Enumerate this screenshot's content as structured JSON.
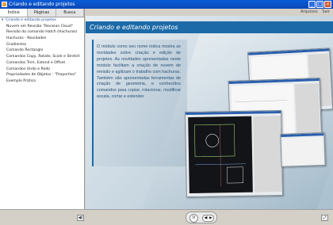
{
  "window": {
    "title": "Criando e editando projetos"
  },
  "top_links": {
    "files": "Arquivos",
    "exit": "Sair"
  },
  "tabs": [
    {
      "label": "Índice",
      "active": true
    },
    {
      "label": "Páginas",
      "active": false
    },
    {
      "label": "Busca",
      "active": false
    }
  ],
  "toc": {
    "parent": "Criando e editando projetos",
    "items": [
      "Nuvem em Revisão \"Revision Cloud\"",
      "Revisão do comando Hatch (Hachuras)",
      "Hachuras - Novidades",
      "Gradientes",
      "Comando Rectangle",
      "Comandos Copy, Rotate, Scale e Stretch",
      "Comandos Trim, Extend e Offset",
      "Comandos Undo e Redo",
      "Propriedades de Objetos - \"Properties\"",
      "Exemplo Prático"
    ]
  },
  "content": {
    "title": "Criando e editando projetos",
    "body": "O módulo como seu nome indica mostra as novidades sobre criação e edição de projetos. As novidades apresentadas neste módulo facilitam a criação de nuvem de revisão e agilizam o trabalho com hachuras. Também são apresentadas ferramentas de criação de geometria, e conhecidos comandos para copiar, rotacionar, modificar escala, cortar e estender."
  },
  "player": {
    "pause_label": "II",
    "volume_label": "◀) ▶"
  },
  "colors": {
    "accent": "#1c6aa8",
    "titlebar": "#0b49b6"
  }
}
